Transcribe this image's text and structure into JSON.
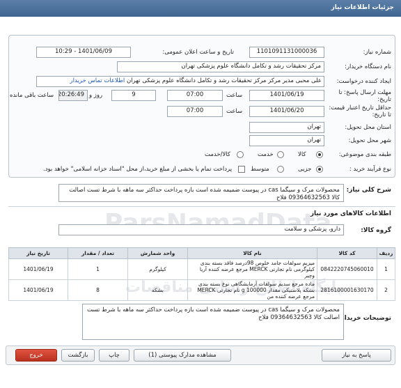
{
  "window": {
    "title": "جزئیات اطلاعات نیاز"
  },
  "watermark": {
    "main": "ParsNamadData",
    "sub": "پایگاه اطلاع رسانی مناقصات"
  },
  "form": {
    "need_number": {
      "label": "شماره نیاز:",
      "value": "1101091131000036"
    },
    "announce": {
      "label": "تاریخ و ساعت اعلان عمومی:",
      "value": "1401/06/09 - 10:29"
    },
    "buyer_org": {
      "label": "نام دستگاه خریدار:",
      "value": "مرکز تحقیقات رشد و تکامل دانشگاه علوم پزشکی تهران"
    },
    "creator": {
      "label": "ایجاد کننده درخواست:",
      "value": "علی محبی مدیر مرکز  مرکز تحقیقات رشد و تکامل دانشگاه علوم پزشکی تهران",
      "contact_link": "اطلاعات تماس خریدار"
    },
    "reply_deadline": {
      "label": "مهلت ارسال پاسخ: تا تاریخ:",
      "date": "1401/06/19",
      "time_label": "ساعت",
      "time": "07:00",
      "days": "9",
      "days_label": "روز و",
      "remaining": "20:26:49",
      "remaining_label": "ساعت باقی مانده"
    },
    "validity": {
      "label": "حداقل تاریخ اعتبار قیمت: تا تاریخ:",
      "date": "1401/06/20",
      "time_label": "ساعت",
      "time": "07:00"
    },
    "province": {
      "label": "استان محل تحویل:",
      "value": "تهران"
    },
    "city": {
      "label": "شهر محل تحویل:",
      "value": "تهران"
    },
    "category": {
      "label": "طبقه بندی موضوعی:",
      "options": [
        "کالا",
        "خدمت",
        "کالا/خدمت"
      ],
      "selected": 0
    },
    "process": {
      "label": "نوع فرآیند خرید :",
      "options": [
        "جزیی",
        "متوسط"
      ],
      "selected": 0,
      "payment_note": "پرداخت تمام یا بخشی از مبلغ خرید،از محل \"اسناد خزانه اسلامی\" خواهد بود."
    }
  },
  "summary": {
    "label": "شرح کلی نیاز:",
    "value": "محصولات مرک و سیگما cas در پیوست ضمیمه شده است بازه پرداخت حداکثر سه ماهه با شرط تست اصالت کالا 09364632563 فلاح"
  },
  "goods": {
    "section_title": "اطلاعات کالاهای مورد نیاز",
    "group_label": "گروه کالا:",
    "group_value": "دارو، پزشکی و سلامت",
    "columns": [
      "ردیف",
      "کد کالا",
      "نام کالا",
      "واحد شمارش",
      "تعداد / مقدار",
      "تاریخ نیاز"
    ],
    "rows": [
      {
        "idx": "1",
        "code": "0842220745060010",
        "name": "میزیم سولفات جامد خلوص 98درصد فاقد بسته بندی کیلوگرمی نام تجارتی MERCK مرجع عرضه کننده آریا وچیر",
        "unit": "کیلوگرم",
        "qty": "1",
        "date": "1401/06/19"
      },
      {
        "idx": "2",
        "code": "2816100001630170",
        "name": "ماده مرجع سدیم سولفات آزمایشگاهی نوع بسته بندی بشکه پلاستیکی مقدار 100000 g نام تجارتی MERCK مرجع عرضه کننده من",
        "unit": "بشکه",
        "qty": "8",
        "date": "1401/06/19"
      }
    ]
  },
  "buyer_notes": {
    "label": "توضیحات خریدار:",
    "value": "محصولات مرک و سیگما cas در پیوست ضمیمه شده است بازه پرداخت حداکثر سه ماهه با شرط تست اصالت کالا 09364632563 فلاح"
  },
  "footer": {
    "reply": "پاسخ به نیاز",
    "docs": "مشاهده مدارک پیوستی (1)",
    "print": "چاپ",
    "back": "بازگشت",
    "exit": "خروج"
  }
}
